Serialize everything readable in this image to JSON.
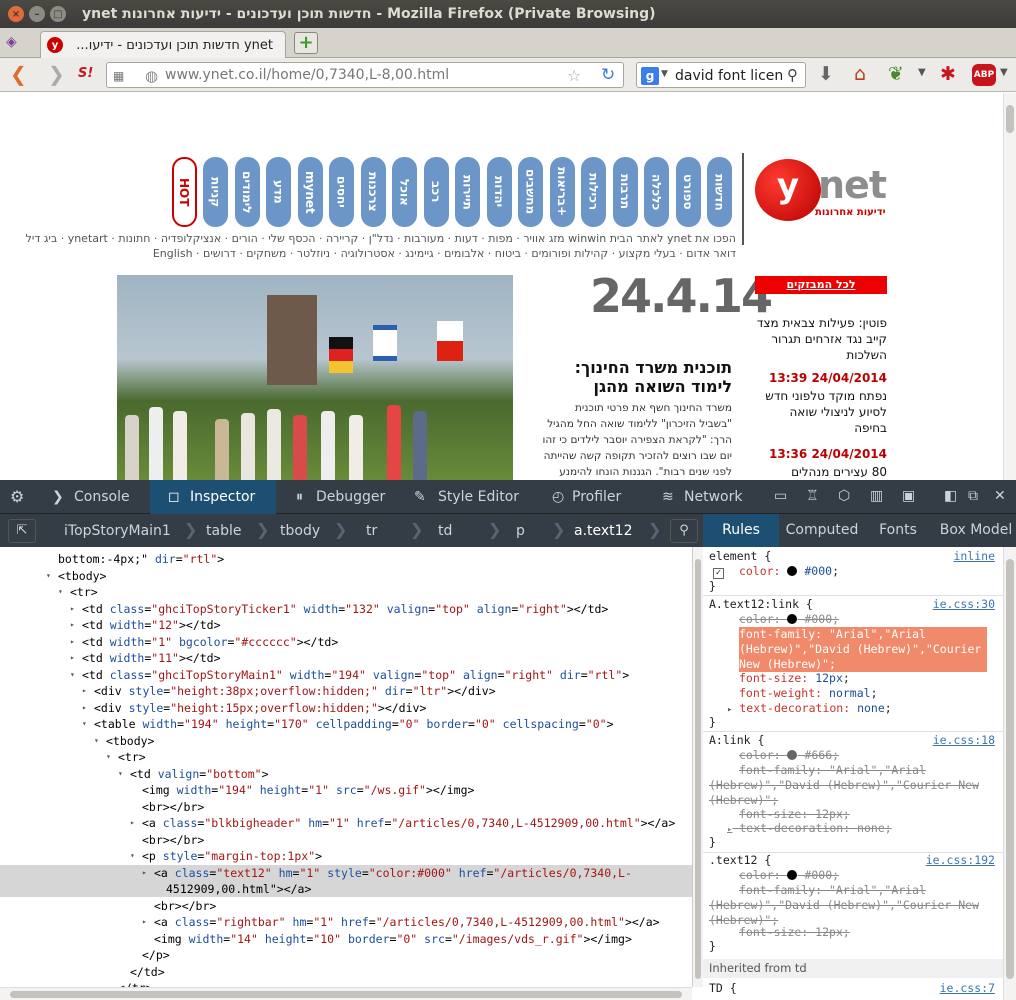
{
  "window": {
    "title": "ynet חדשות תוכן ועדכונים - ידיעות אחרונות - Mozilla Firefox (Private Browsing)"
  },
  "tab": {
    "favicon": "y",
    "title": "ynet חדשות תוכן ועדכונים - ידיעו...",
    "close": "×"
  },
  "navbar": {
    "url": "www.ynet.co.il/home/0,7340,L-8,00.html",
    "search_query": "david font licensi",
    "search_engine": "g"
  },
  "page": {
    "logo_letter": "y",
    "logo_word": "net",
    "logo_sub": "ידיעות אחרונות",
    "menu_pills": [
      "חדשות",
      "ספורט",
      "כלכלה",
      "תרבות",
      "רכילות",
      "בריאות+",
      "מחשבים",
      "יהדות",
      "תיירות",
      "רכב",
      "אוכל",
      "צרכנות",
      "יחסים",
      "mynet",
      "מדע",
      "לימודים",
      "קניות",
      "HOT"
    ],
    "toplinks_1": "הפכו את ynet לאתר הבית   winwin מזג אוויר · מפות · דעות · מעורבות · נדל\"ן · קריירה · הכסף שלי · הורים · אנציקלופדיה · חתונות · ynetart · ביג דיל",
    "toplinks_2": "דואר אדום · בעלי מקצוע · קהילות ופורומים · ביטוח · אלבומים · גיימינג · אסטרולוגיה · ניוזלטר · משחקים · דרושים · English",
    "home_link": "הפכו את ynet לאתר הבית",
    "mail_red": "דואר אדום",
    "date": "24.4.14",
    "headline": "תוכנית משרד החינוך: לימוד השואה מהגן",
    "blurb": "משרד החינוך חשף את פרטי תוכנית \"בשביל הזיכרון\" ללימוד שואה החל מהגיל הרך: \"לקראת הצפירה יוסבר לילדים כי זהו יום שבו רוצים להזכיר תקופה קשה שהייתה לפני שנים רבות\". הגננות הונחו להימנע מהמחשות פיזיות (מקשות",
    "ticker_header": "לכל המבזקים",
    "ticker": [
      {
        "text": "פוטין: פעילות צבאית מצד קייב נגד אזרחים תגרור השלכות",
        "time": ""
      },
      {
        "text": "",
        "time": "24/04/2014 13:39"
      },
      {
        "text": "נפתח מוקד טלפוני חדש לסיוע לניצולי שואה בחיפה",
        "time": ""
      },
      {
        "text": "",
        "time": "24/04/2014 13:36"
      },
      {
        "text": "80 עצירים מנהלים",
        "time": ""
      }
    ]
  },
  "devtools": {
    "tabs": [
      "Console",
      "Inspector",
      "Debugger",
      "Style Editor",
      "Profiler",
      "Network"
    ],
    "active_tab": "Inspector",
    "breadcrumbs": [
      "iTopStoryMain1",
      "table",
      "tbody",
      "tr",
      "td",
      "p",
      "a.text12"
    ],
    "side_tabs": [
      "Rules",
      "Computed",
      "Fonts",
      "Box Model"
    ],
    "active_side_tab": "Rules",
    "markup_lines": [
      {
        "indent": 58,
        "twisty": "",
        "html": "bottom:-4px;\" dir=\"rtl\">"
      },
      {
        "indent": 58,
        "twisty": "▾",
        "html": "<tbody>"
      },
      {
        "indent": 70,
        "twisty": "▾",
        "html": "<tr>"
      },
      {
        "indent": 82,
        "twisty": "▸",
        "html": "<td class=\"ghciTopStoryTicker1\" width=\"132\" valign=\"top\" align=\"right\"></td>"
      },
      {
        "indent": 82,
        "twisty": "▸",
        "html": "<td width=\"12\"></td>"
      },
      {
        "indent": 82,
        "twisty": "▸",
        "html": "<td width=\"1\" bgcolor=\"#cccccc\"></td>"
      },
      {
        "indent": 82,
        "twisty": "▸",
        "html": "<td width=\"11\"></td>"
      },
      {
        "indent": 82,
        "twisty": "▾",
        "html": "<td class=\"ghciTopStoryMain1\" width=\"194\" valign=\"top\" align=\"right\" dir=\"rtl\">"
      },
      {
        "indent": 94,
        "twisty": "▸",
        "html": "<div style=\"height:38px;overflow:hidden;\" dir=\"ltr\"></div>"
      },
      {
        "indent": 94,
        "twisty": "▸",
        "html": "<div style=\"height:15px;overflow:hidden;\"></div>"
      },
      {
        "indent": 94,
        "twisty": "▾",
        "html": "<table width=\"194\" height=\"170\" cellpadding=\"0\" border=\"0\" cellspacing=\"0\">"
      },
      {
        "indent": 106,
        "twisty": "▾",
        "html": "<tbody>"
      },
      {
        "indent": 118,
        "twisty": "▾",
        "html": "<tr>"
      },
      {
        "indent": 130,
        "twisty": "▾",
        "html": "<td valign=\"bottom\">"
      },
      {
        "indent": 142,
        "twisty": "",
        "html": "<img width=\"194\" height=\"1\" src=\"/ws.gif\"></img>"
      },
      {
        "indent": 142,
        "twisty": "",
        "html": "<br></br>"
      },
      {
        "indent": 142,
        "twisty": "▸",
        "html": "<a class=\"blkbigheader\" hm=\"1\" href=\"/articles/0,7340,L-4512909,00.html\"></a>"
      },
      {
        "indent": 142,
        "twisty": "",
        "html": "<br></br>"
      },
      {
        "indent": 142,
        "twisty": "▾",
        "html": "<p style=\"margin-top:1px\">"
      },
      {
        "indent": 154,
        "twisty": "▸",
        "html": "<a class=\"text12\" hm=\"1\" style=\"color:#000\" href=\"/articles/0,7340,L-",
        "sel": true
      },
      {
        "indent": 166,
        "twisty": "",
        "html": "4512909,00.html\"></a>",
        "sel": true
      },
      {
        "indent": 154,
        "twisty": "",
        "html": "<br></br>"
      },
      {
        "indent": 154,
        "twisty": "▸",
        "html": "<a class=\"rightbar\" hm=\"1\" href=\"/articles/0,7340,L-4512909,00.html\"></a>"
      },
      {
        "indent": 154,
        "twisty": "",
        "html": "<img width=\"14\" height=\"10\" border=\"0\" src=\"/images/vds_r.gif\"></img>"
      },
      {
        "indent": 142,
        "twisty": "",
        "html": "</p>"
      },
      {
        "indent": 130,
        "twisty": "",
        "html": "</td>"
      },
      {
        "indent": 118,
        "twisty": "",
        "html": "</tr>"
      }
    ],
    "rules": {
      "element_selector": "element {",
      "element_source": "inline",
      "element_color": "#000",
      "r1_selector": "A.text12:link {",
      "r1_source": "ie.css:30",
      "r1_color": "#000",
      "r1_font_family": "font-family: \"Arial\",\"Arial (Hebrew)\",\"David (Hebrew)\",\"Courier New (Hebrew)\";",
      "r1_font_size": "12px",
      "r1_font_weight": "normal",
      "r1_text_decoration": "none",
      "r2_selector": "A:link {",
      "r2_source": "ie.css:18",
      "r2_color": "#666",
      "r2_font_family": "font-family: \"Arial\",\"Arial (Hebrew)\",\"David (Hebrew)\",\"Courier New (Hebrew)\";",
      "r2_font_size": "12px",
      "r2_text_decoration": "none",
      "r3_selector": ".text12 {",
      "r3_source": "ie.css:192",
      "r3_color": "#000",
      "r3_font_family": "font-family: \"Arial\",\"Arial (Hebrew)\",\"David (Hebrew)\",\"Courier New (Hebrew)\";",
      "r3_font_size": "12px",
      "inherited": "Inherited from td",
      "r4_selector": "TD {",
      "r4_source": "ie.css:7"
    }
  },
  "colors": {
    "ynet_red": "#cc0000",
    "devtools_dark": "#343c45",
    "devtools_active": "#1d4f73",
    "highlight": "#f08a6b"
  }
}
